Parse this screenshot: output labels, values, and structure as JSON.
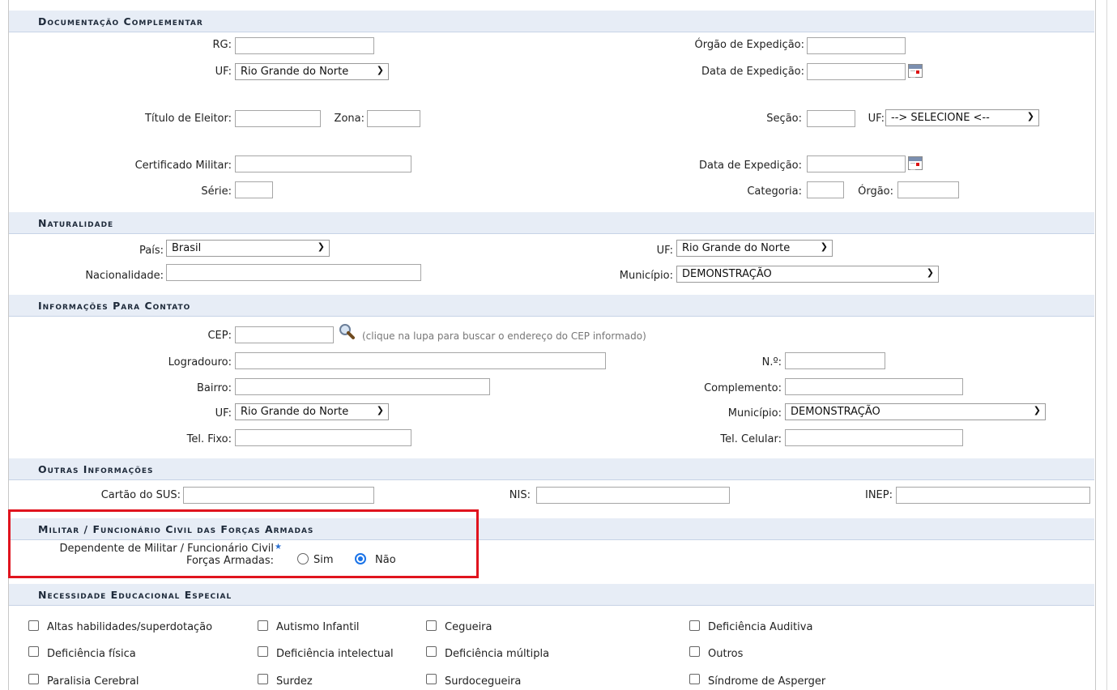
{
  "documentacao": {
    "title": "Documentação Complementar",
    "rg_label": "RG:",
    "orgao_expedicao_label": "Órgão de Expedição:",
    "uf_label": "UF:",
    "uf_value": "Rio Grande do Norte",
    "data_expedicao_label": "Data de Expedição:",
    "titulo_eleitor_label": "Título de Eleitor:",
    "zona_label": "Zona:",
    "secao_label": "Seção:",
    "uf_eleitor_label": "UF:",
    "uf_eleitor_value": "--> SELECIONE <--",
    "certificado_militar_label": "Certificado Militar:",
    "data_expedicao2_label": "Data de Expedição:",
    "serie_label": "Série:",
    "categoria_label": "Categoria:",
    "orgao_label": "Órgão:"
  },
  "naturalidade": {
    "title": "Naturalidade",
    "pais_label": "País:",
    "pais_value": "Brasil",
    "uf_label": "UF:",
    "uf_value": "Rio Grande do Norte",
    "nacionalidade_label": "Nacionalidade:",
    "municipio_label": "Município:",
    "municipio_value": "DEMONSTRAÇÃO"
  },
  "contato": {
    "title": "Informações Para Contato",
    "cep_label": "CEP:",
    "cep_hint": "(clique na lupa para buscar o endereço do CEP informado)",
    "logradouro_label": "Logradouro:",
    "numero_label": "N.º:",
    "bairro_label": "Bairro:",
    "complemento_label": "Complemento:",
    "uf_label": "UF:",
    "uf_value": "Rio Grande do Norte",
    "municipio_label": "Município:",
    "municipio_value": "DEMONSTRAÇÃO",
    "tel_fixo_label": "Tel. Fixo:",
    "tel_celular_label": "Tel. Celular:"
  },
  "outras": {
    "title": "Outras Informações",
    "sus_label": "Cartão do SUS:",
    "nis_label": "NIS:",
    "inep_label": "INEP:"
  },
  "militar": {
    "title": "Militar / Funcionário Civil das Forças Armadas",
    "question_line1": "Dependente de Militar / Funcionário Civil",
    "question_line2": "Forças Armadas:",
    "sim_label": "Sim",
    "nao_label": "Não",
    "selected": "Não"
  },
  "necessidade": {
    "title": "Necessidade Educacional Especial",
    "items": [
      "Altas habilidades/superdotação",
      "Autismo Infantil",
      "Cegueira",
      "Deficiência Auditiva",
      "Deficiência física",
      "Deficiência intelectual",
      "Deficiência múltipla",
      "Outros",
      "Paralisia Cerebral",
      "Surdez",
      "Surdocegueira",
      "Síndrome de Asperger"
    ]
  },
  "colors": {
    "section_bg": "#e7edf6",
    "highlight_border": "#e0141e",
    "radio_accent": "#1a73e8"
  }
}
